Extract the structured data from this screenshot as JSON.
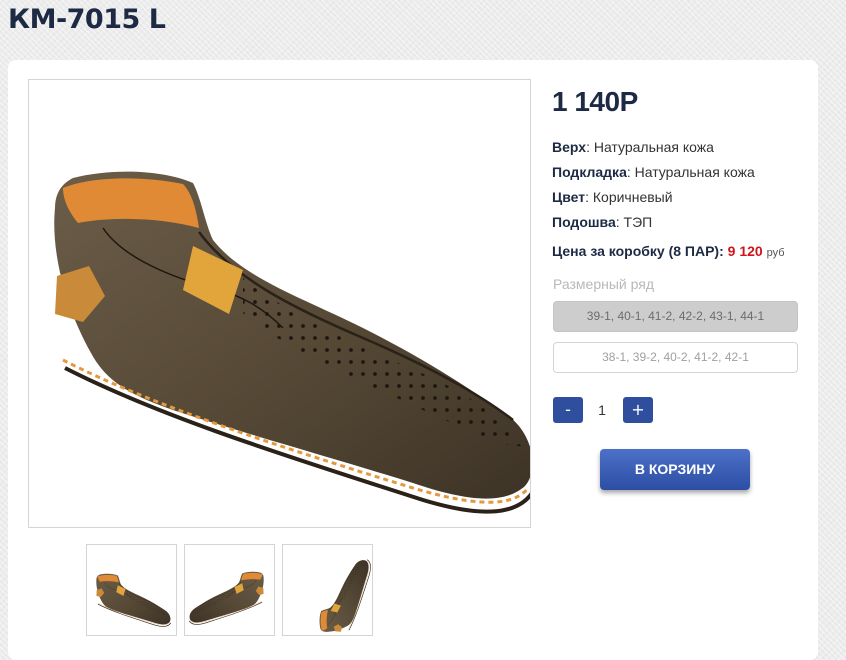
{
  "product": {
    "title": "КМ-7015 L",
    "price": "1 140Р",
    "specs": [
      {
        "label": "Верх",
        "value": ": Натуральная кожа"
      },
      {
        "label": "Подкладка",
        "value": ": Натуральная кожа"
      },
      {
        "label": "Цвет",
        "value": ": Коричневый"
      },
      {
        "label": "Подошва",
        "value": ": ТЭП"
      }
    ],
    "box_price": {
      "label": "Цена за коробку (8 ПАР): ",
      "value": "9 120",
      "unit": "руб"
    }
  },
  "sizes": {
    "label": "Размерный ряд",
    "options": [
      "39-1, 40-1, 41-2, 42-2, 43-1, 44-1",
      "38-1, 39-2, 40-2, 41-2, 42-1"
    ],
    "selected_index": 0
  },
  "quantity": {
    "minus": "-",
    "value": "1",
    "plus": "+"
  },
  "cart_button": "В КОРЗИНУ",
  "colors": {
    "primary": "#2f4f9e",
    "price_red": "#d0131c",
    "title": "#1d2a44"
  }
}
